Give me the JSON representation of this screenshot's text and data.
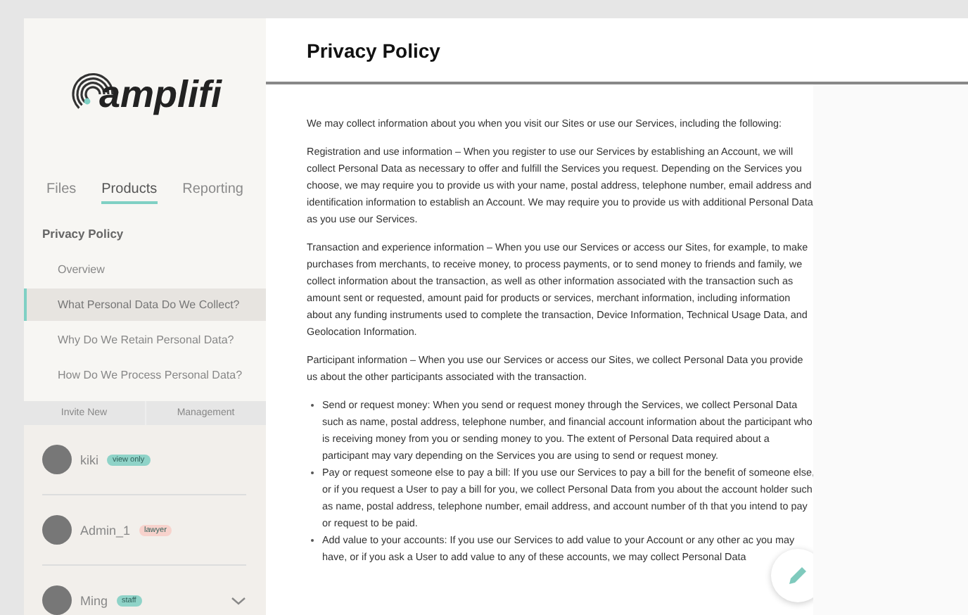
{
  "sidebar": {
    "logo": "amplifi",
    "tabs": [
      {
        "label": "Files",
        "selected": false
      },
      {
        "label": "Products",
        "selected": true
      },
      {
        "label": "Reporting",
        "selected": false
      }
    ],
    "section": "Privacy Policy",
    "items": [
      {
        "label": "Overview",
        "selected": false
      },
      {
        "label": "What Personal Data Do We Collect?",
        "selected": true
      },
      {
        "label": "Why Do We Retain Personal Data?",
        "selected": false
      },
      {
        "label": "How Do We Process Personal Data?",
        "selected": false
      }
    ],
    "user_tabs": [
      "Invite New",
      "Management"
    ],
    "users": [
      {
        "name": "kiki",
        "badge": "view only",
        "color": "#8fd3c8",
        "expandable": false
      },
      {
        "name": "Admin_1",
        "badge": "lawyer",
        "color": "#f7d2cc",
        "expandable": false
      },
      {
        "name": "Ming",
        "badge": "staff",
        "color": "#8fd3c8",
        "expandable": true
      }
    ]
  },
  "main": {
    "title": "Privacy Policy",
    "paragraphs": [
      "We may collect information about you when you visit our Sites or use our Services, including the following:",
      "Registration and use information – When you register to use our Services by establishing an Account, we will collect Personal Data as necessary to offer and fulfill the Services you request. Depending on the Services you choose, we may require you to provide us with your name, postal address, telephone number, email address and identification information to establish an Account. We may require you to provide us with additional Personal Data as you use our Services.",
      "Transaction and experience information – When you use our Services or access our Sites, for example, to make purchases from merchants, to receive money, to process payments, or to send money to friends and family, we collect information about the transaction, as well as other information associated with the transaction such as amount sent or requested, amount paid for products or services, merchant information, including information about any funding instruments used to complete the transaction, Device Information, Technical Usage Data, and Geolocation Information.",
      "Participant information – When you use our Services or access our Sites, we collect Personal Data you provide us about the other participants associated with the transaction."
    ],
    "bullets": [
      "Send or request money: When you send or request money through the Services, we collect Personal Data such as name, postal address, telephone number, and financial account information about the participant who is receiving money from you or sending money to you. The extent of Personal Data required about a participant may vary depending on the Services you are using to send or request money.",
      "Pay or request someone else to pay a bill: If you use our Services to pay a bill for the benefit of someone else, or if you request a User to pay a bill for you, we collect Personal Data from you about the account holder such as name, postal address, telephone number, email address, and account number of th that you intend to pay or request to be paid.",
      "Add value to your accounts: If you use our Services to add value to your Account or any other ac you may have, or if you ask a User to add value to any of these accounts, we may collect Personal Data"
    ]
  }
}
